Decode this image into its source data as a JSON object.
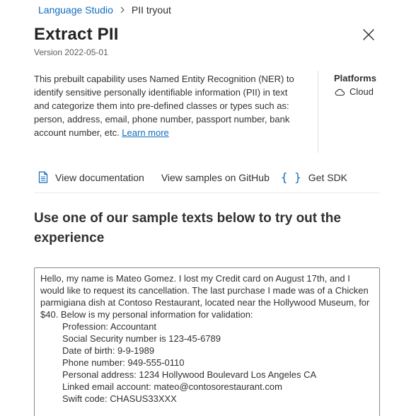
{
  "breadcrumb": {
    "root": "Language Studio",
    "current": "PII tryout"
  },
  "header": {
    "title": "Extract PII",
    "version": "Version 2022-05-01"
  },
  "description": {
    "text": "This prebuilt capability uses Named Entity Recognition (NER) to identify sensitive personally identifiable information (PII) in text and categorize them into pre-defined classes or types such as: person, address, email, phone number, passport number, bank account number, etc. ",
    "link": "Learn more"
  },
  "platforms": {
    "title": "Platforms",
    "item": "Cloud"
  },
  "links": {
    "documentation": "View documentation",
    "github": "View samples on GitHub",
    "sdk": "Get SDK"
  },
  "section": {
    "title": "Use one of our sample texts below to try out the experience"
  },
  "sample": {
    "intro": "Hello, my name is Mateo Gomez. I lost my Credit card on August 17th, and I would like to request its cancellation. The last purchase I made was of a Chicken parmigiana dish at Contoso Restaurant, located near the Hollywood Museum, for $40. Below is my personal information for validation:",
    "details": [
      "Profession: Accountant",
      "Social Security number is 123-45-6789",
      "Date of birth: 9-9-1989",
      "Phone number: 949-555-0110",
      "Personal address: 1234 Hollywood Boulevard Los Angeles CA",
      "Linked email account: mateo@contosorestaurant.com",
      "Swift code: CHASUS33XXX"
    ]
  },
  "icons": {
    "separator": "chevron-right-icon",
    "close": "close-icon",
    "platform": "cloud-icon",
    "documentation": "document-icon",
    "sdk": "code-braces-icon"
  },
  "colors": {
    "link": "#0f6cbd",
    "text": "#323130",
    "muted": "#605e5c",
    "border": "#8a8886"
  }
}
